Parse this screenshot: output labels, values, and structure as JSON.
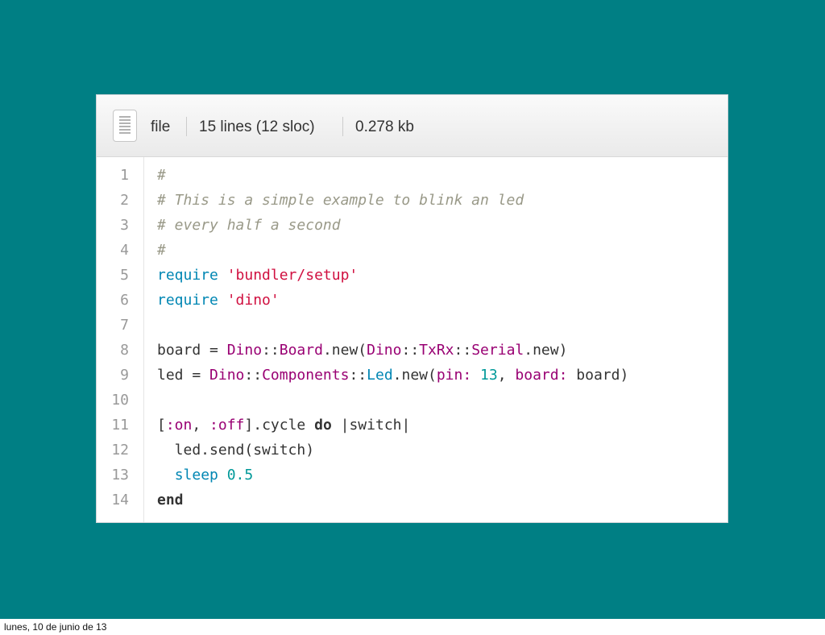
{
  "file_header": {
    "label": "file",
    "lines_info": "15 lines (12 sloc)",
    "size": "0.278 kb"
  },
  "code_lines": [
    {
      "no": "1",
      "tokens": [
        {
          "t": "#",
          "c": "comment"
        }
      ]
    },
    {
      "no": "2",
      "tokens": [
        {
          "t": "# This is a simple example to blink an led",
          "c": "comment"
        }
      ]
    },
    {
      "no": "3",
      "tokens": [
        {
          "t": "# every half a second",
          "c": "comment"
        }
      ]
    },
    {
      "no": "4",
      "tokens": [
        {
          "t": "#",
          "c": "comment"
        }
      ]
    },
    {
      "no": "5",
      "tokens": [
        {
          "t": "require",
          "c": "keyword"
        },
        {
          "t": " ",
          "c": ""
        },
        {
          "t": "'bundler/setup'",
          "c": "string"
        }
      ]
    },
    {
      "no": "6",
      "tokens": [
        {
          "t": "require",
          "c": "keyword"
        },
        {
          "t": " ",
          "c": ""
        },
        {
          "t": "'dino'",
          "c": "string"
        }
      ]
    },
    {
      "no": "7",
      "tokens": []
    },
    {
      "no": "8",
      "tokens": [
        {
          "t": "board = ",
          "c": ""
        },
        {
          "t": "Dino",
          "c": "const"
        },
        {
          "t": "::",
          "c": ""
        },
        {
          "t": "Board",
          "c": "const"
        },
        {
          "t": ".new(",
          "c": ""
        },
        {
          "t": "Dino",
          "c": "const"
        },
        {
          "t": "::",
          "c": ""
        },
        {
          "t": "TxRx",
          "c": "const"
        },
        {
          "t": "::",
          "c": ""
        },
        {
          "t": "Serial",
          "c": "const"
        },
        {
          "t": ".new)",
          "c": ""
        }
      ]
    },
    {
      "no": "9",
      "tokens": [
        {
          "t": "led = ",
          "c": ""
        },
        {
          "t": "Dino",
          "c": "const"
        },
        {
          "t": "::",
          "c": ""
        },
        {
          "t": "Components",
          "c": "const"
        },
        {
          "t": "::",
          "c": ""
        },
        {
          "t": "Led",
          "c": "keyword"
        },
        {
          "t": ".new(",
          "c": ""
        },
        {
          "t": "pin:",
          "c": "const"
        },
        {
          "t": " ",
          "c": ""
        },
        {
          "t": "13",
          "c": "num"
        },
        {
          "t": ", ",
          "c": ""
        },
        {
          "t": "board:",
          "c": "const"
        },
        {
          "t": " board)",
          "c": ""
        }
      ]
    },
    {
      "no": "10",
      "tokens": []
    },
    {
      "no": "11",
      "tokens": [
        {
          "t": "[",
          "c": ""
        },
        {
          "t": ":on",
          "c": "const"
        },
        {
          "t": ", ",
          "c": ""
        },
        {
          "t": ":off",
          "c": "const"
        },
        {
          "t": "].cycle ",
          "c": ""
        },
        {
          "t": "do",
          "c": "bold"
        },
        {
          "t": " |switch|",
          "c": ""
        }
      ]
    },
    {
      "no": "12",
      "tokens": [
        {
          "t": "  led.send(switch)",
          "c": ""
        }
      ]
    },
    {
      "no": "13",
      "tokens": [
        {
          "t": "  ",
          "c": ""
        },
        {
          "t": "sleep",
          "c": "keyword"
        },
        {
          "t": " ",
          "c": ""
        },
        {
          "t": "0.5",
          "c": "num"
        }
      ]
    },
    {
      "no": "14",
      "tokens": [
        {
          "t": "end",
          "c": "bold"
        }
      ]
    }
  ],
  "footer": {
    "date_text": "lunes, 10 de junio de 13"
  },
  "colors": {
    "slide_background": "#007f84",
    "comment": "#999988",
    "keyword": "#0086b3",
    "string": "#d01040",
    "constant": "#990073",
    "number": "#009999"
  }
}
